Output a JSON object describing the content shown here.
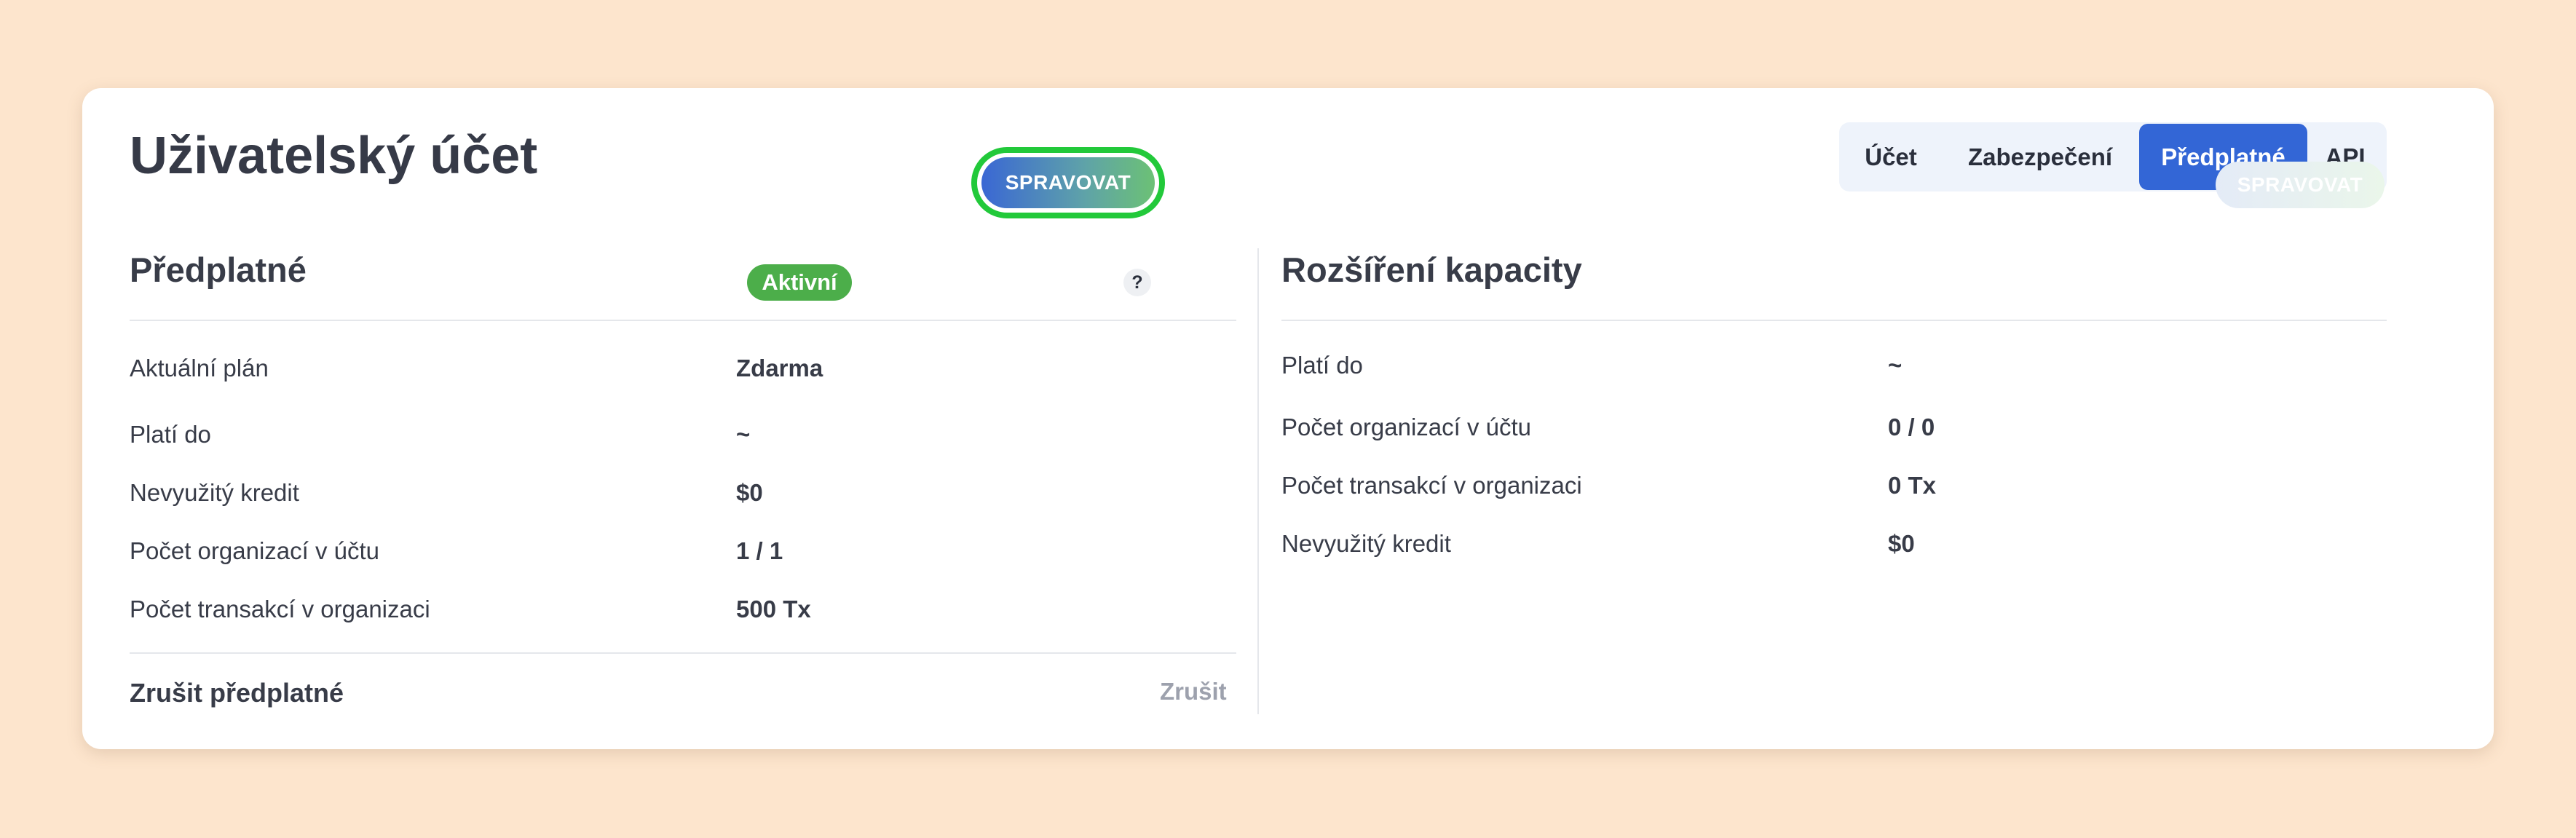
{
  "header": {
    "title": "Uživatelský účet"
  },
  "tabs": [
    {
      "label": "Účet"
    },
    {
      "label": "Zabezpečení"
    },
    {
      "label": "Předplatné"
    },
    {
      "label": "API"
    }
  ],
  "subscription": {
    "title": "Předplatné",
    "manage_label": "SPRAVOVAT",
    "plan_label": "Aktuální plán",
    "plan_value": "Zdarma",
    "status_badge": "Aktivní",
    "help_icon": "?",
    "rows": [
      {
        "label": "Platí do",
        "value": "~"
      },
      {
        "label": "Nevyužitý kredit",
        "value": "$0"
      },
      {
        "label": "Počet organizací v účtu",
        "value": "1 / 1"
      },
      {
        "label": "Počet transakcí v organizaci",
        "value": "500 Tx"
      }
    ],
    "cancel_title": "Zrušit předplatné",
    "cancel_label": "Zrušit"
  },
  "capacity": {
    "title": "Rozšíření kapacity",
    "manage_label": "SPRAVOVAT",
    "rows": [
      {
        "label": "Platí do",
        "value": "~"
      },
      {
        "label": "Počet organizací v účtu",
        "value": "0 / 0"
      },
      {
        "label": "Počet transakcí v organizaci",
        "value": "0 Tx"
      },
      {
        "label": "Nevyužitý kredit",
        "value": "$0"
      }
    ]
  },
  "colors": {
    "background": "#fde5cd",
    "accent": "#3366d6",
    "success": "#4cae4a",
    "highlight": "#22c93a"
  }
}
